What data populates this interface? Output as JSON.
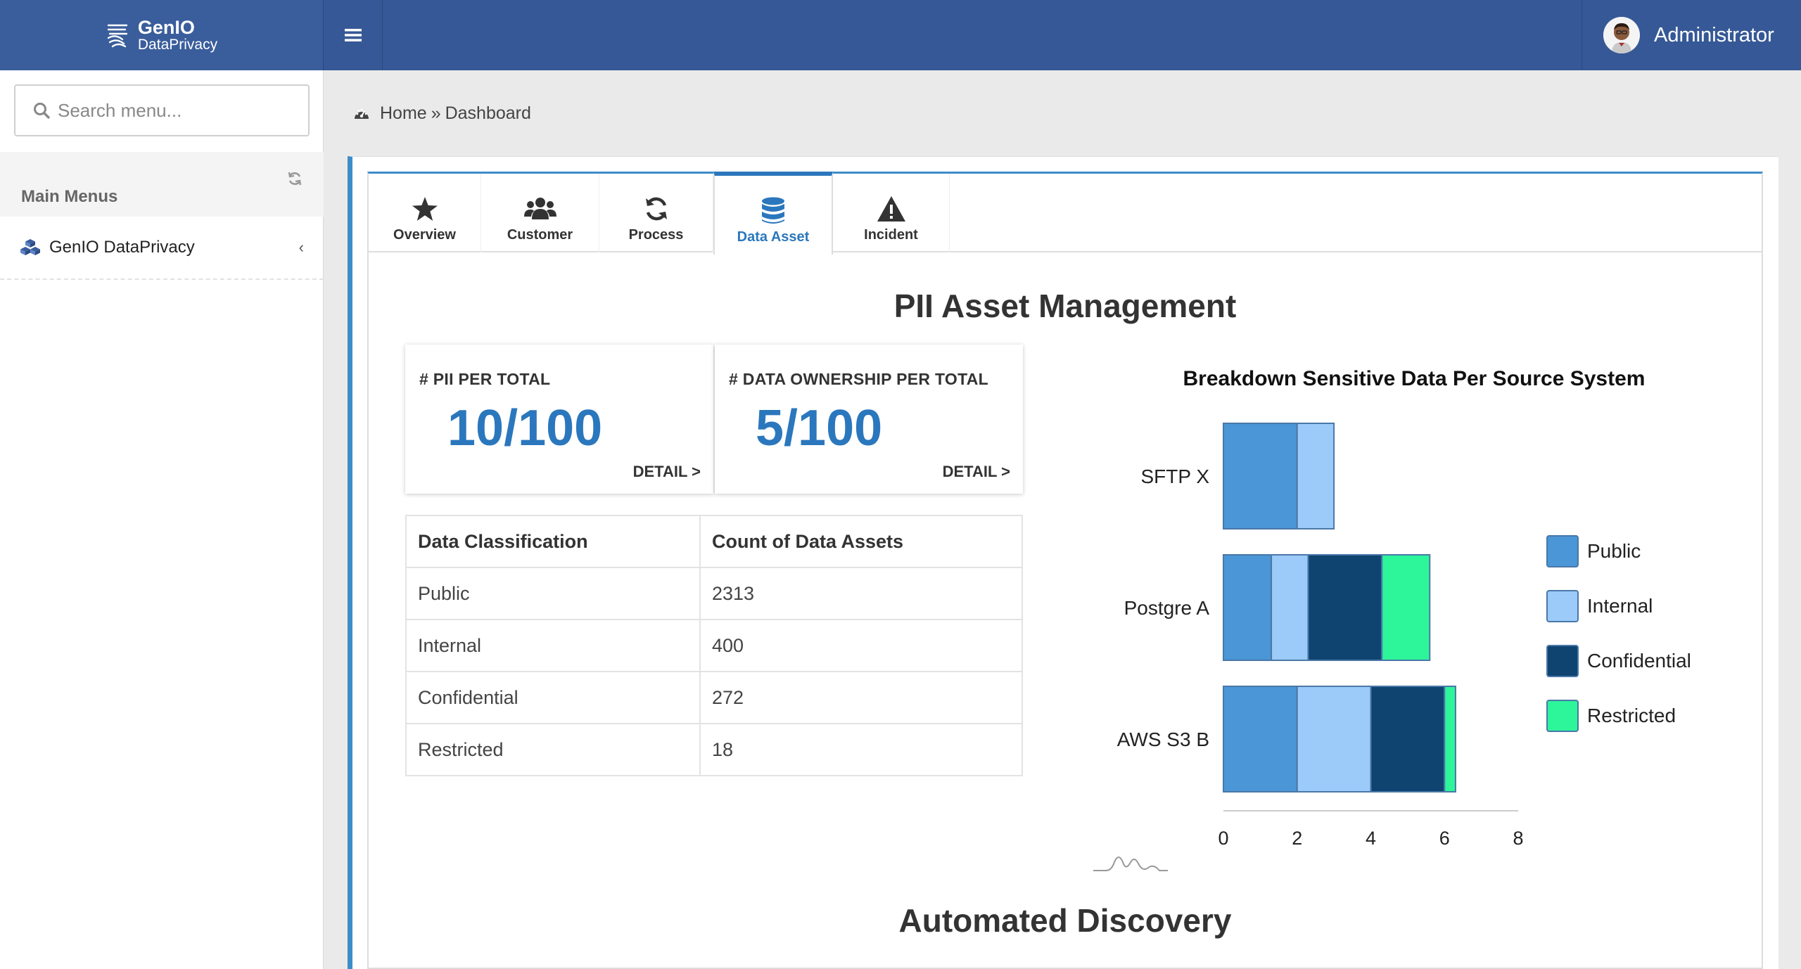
{
  "brand": {
    "line1": "GenIO",
    "line2": "DataPrivacy"
  },
  "user": {
    "name": "Administrator"
  },
  "sidebar": {
    "search_placeholder": "Search menu...",
    "menu_header": "Main Menus",
    "items": [
      {
        "label": "GenIO DataPrivacy",
        "chevron": "‹"
      }
    ]
  },
  "breadcrumb": {
    "home": "Home",
    "separator": "»",
    "current": "Dashboard"
  },
  "tabs": [
    {
      "label": "Overview",
      "icon": "star-icon"
    },
    {
      "label": "Customer",
      "icon": "users-icon"
    },
    {
      "label": "Process",
      "icon": "refresh-icon"
    },
    {
      "label": "Data Asset",
      "icon": "database-icon",
      "active": true
    },
    {
      "label": "Incident",
      "icon": "warning-icon"
    }
  ],
  "section": {
    "title": "PII Asset Management",
    "next_title": "Automated Discovery"
  },
  "kpis": [
    {
      "label": "# PII PER TOTAL",
      "value": "10/100",
      "detail": "DETAIL >"
    },
    {
      "label": "# DATA OWNERSHIP PER TOTAL",
      "value": "5/100",
      "detail": "DETAIL >"
    }
  ],
  "classification_table": {
    "headers": [
      "Data Classification",
      "Count of Data Assets"
    ],
    "rows": [
      [
        "Public",
        "2313"
      ],
      [
        "Internal",
        "400"
      ],
      [
        "Confidential",
        "272"
      ],
      [
        "Restricted",
        "18"
      ]
    ]
  },
  "colors": {
    "public": "#4a96d6",
    "internal": "#9ccbf9",
    "confidential": "#0f4370",
    "restricted": "#2cf59a",
    "accent": "#2b77bd",
    "topbar": "#365896"
  },
  "chart_data": {
    "type": "bar",
    "orientation": "horizontal",
    "stacked": true,
    "title": "Breakdown Sensitive Data Per Source System",
    "categories": [
      "SFTP X",
      "Postgre A",
      "AWS S3 B"
    ],
    "series": [
      {
        "name": "Public",
        "color": "#4a96d6",
        "values": [
          2,
          1.3,
          2
        ]
      },
      {
        "name": "Internal",
        "color": "#9ccbf9",
        "values": [
          1,
          1,
          2
        ]
      },
      {
        "name": "Confidential",
        "color": "#0f4370",
        "values": [
          0,
          2,
          2
        ]
      },
      {
        "name": "Restricted",
        "color": "#2cf59a",
        "values": [
          0,
          1.3,
          0.3
        ]
      }
    ],
    "xlim": [
      0,
      8
    ],
    "xticks": [
      0,
      2,
      4,
      6,
      8
    ],
    "legend": "right",
    "grid": false
  }
}
